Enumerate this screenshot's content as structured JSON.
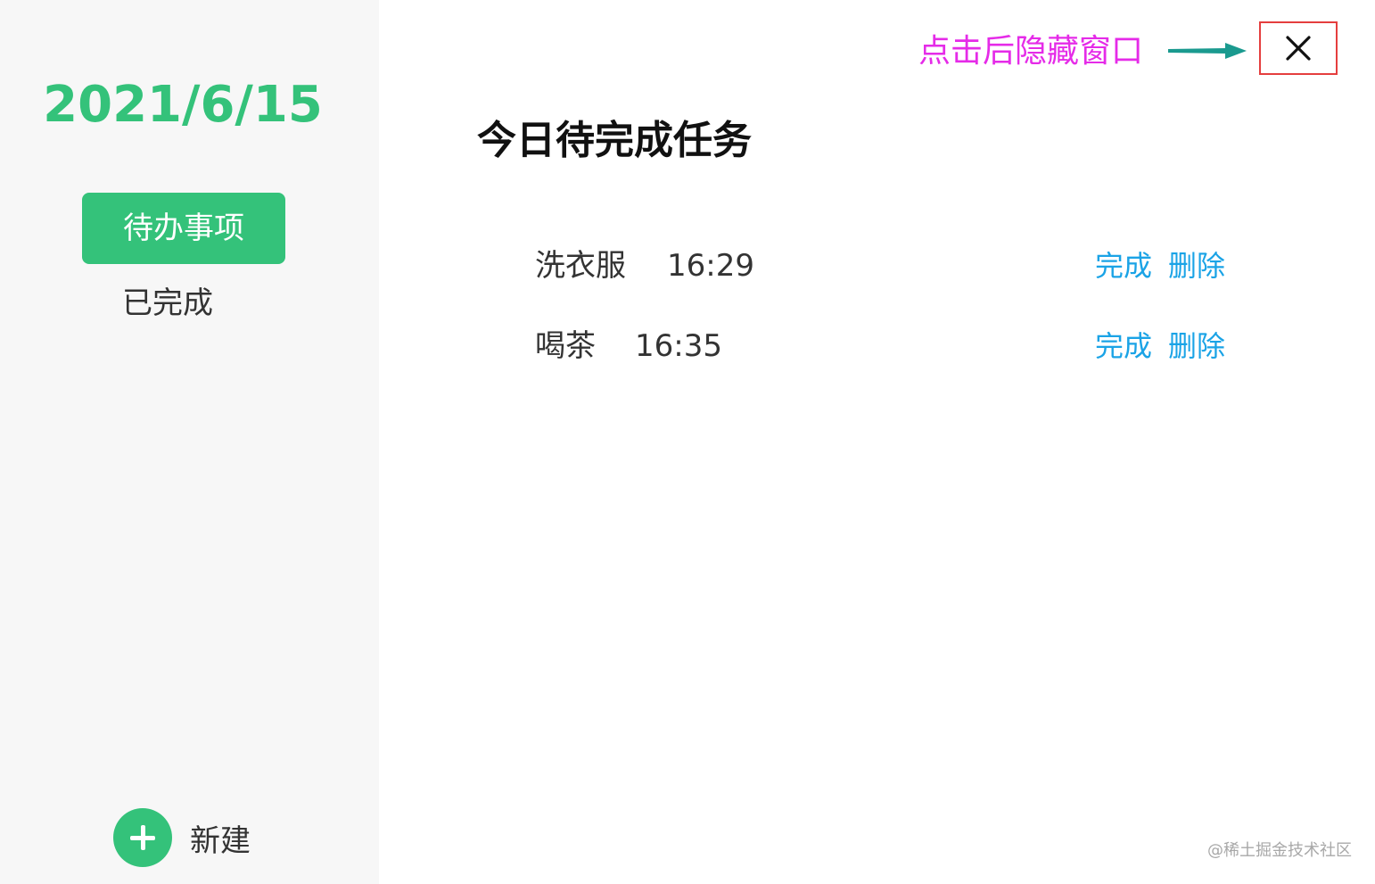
{
  "sidebar": {
    "date": "2021/6/15",
    "nav": [
      {
        "label": "待办事项",
        "active": true
      },
      {
        "label": "已完成",
        "active": false
      }
    ],
    "new_label": "新建"
  },
  "main": {
    "annotation": "点击后隐藏窗口",
    "close_icon": "close-x-icon",
    "title": "今日待完成任务",
    "tasks": [
      {
        "name": "洗衣服",
        "time": "16:29",
        "done_label": "完成",
        "delete_label": "删除"
      },
      {
        "name": "喝茶",
        "time": "16:35",
        "done_label": "完成",
        "delete_label": "删除"
      }
    ]
  },
  "watermark": "@稀土掘金技术社区",
  "colors": {
    "accent": "#34c27a",
    "link": "#1aa3e6",
    "annotation": "#e52be8",
    "highlight_box": "#e53e3e",
    "arrow": "#1a9a8f"
  }
}
